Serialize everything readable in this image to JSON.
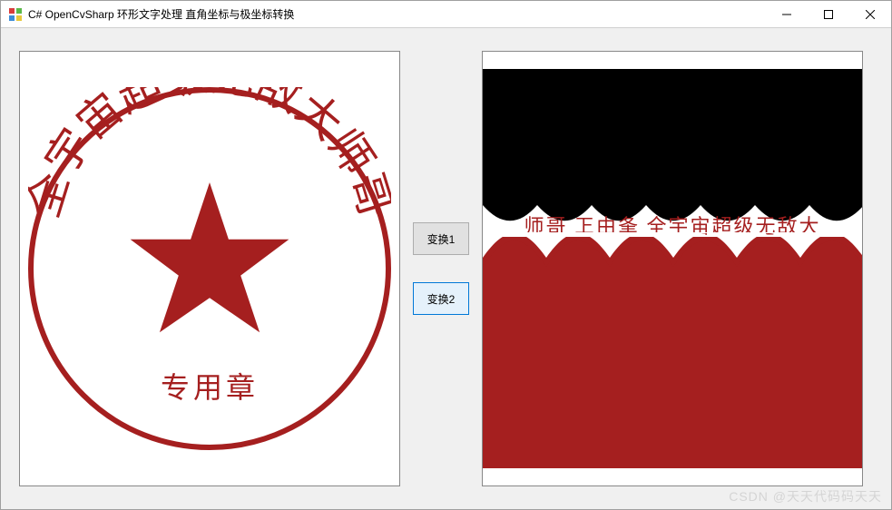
{
  "window": {
    "title": "C# OpenCvSharp 环形文字处理 直角坐标与极坐标转换"
  },
  "buttons": {
    "transform1": "变换1",
    "transform2": "变换2"
  },
  "seal": {
    "arc_text": "全宇宙超级无敌大师哥",
    "bottom_text": "专用章"
  },
  "unwrapped": {
    "text_line": "师哥 㠪由夆 全宇宙超级无敌大"
  },
  "watermark": "CSDN @天天代码码天天",
  "colors": {
    "seal_red": "#a51f1f",
    "window_bg": "#f0f0f0"
  }
}
